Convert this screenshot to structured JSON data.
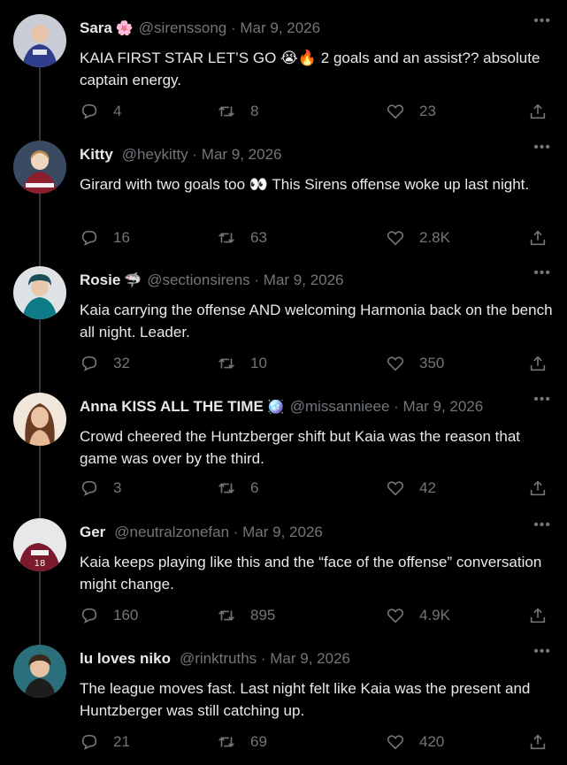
{
  "tweets": [
    {
      "name": "Sara",
      "emoji": "🌸",
      "handle": "@sirenssong",
      "date": "Mar 9, 2026",
      "text": "KAIA FIRST STAR LET’S GO 😭🔥 2 goals and an assist?? absolute captain energy.",
      "replies": "4",
      "retweets": "8",
      "likes": "23"
    },
    {
      "name": "Kitty",
      "emoji": "",
      "handle": "@heykitty",
      "date": "Mar 9, 2026",
      "text": "Girard with two goals too 👀 This Sirens offense woke up last night.",
      "replies": "16",
      "retweets": "63",
      "likes": "2.8K"
    },
    {
      "name": "Rosie",
      "emoji": "🦈",
      "handle": "@sectionsirens",
      "date": "Mar 9, 2026",
      "text": "Kaia carrying the offense AND welcoming Harmonia back on the bench all night. Leader.",
      "replies": "32",
      "retweets": "10",
      "likes": "350"
    },
    {
      "name": "Anna KISS ALL THE TIME",
      "emoji": "🪩",
      "handle": "@missannieee",
      "date": "Mar 9, 2026",
      "text": "Crowd cheered the Huntzberger shift but Kaia was the reason that game was over by the third.",
      "replies": "3",
      "retweets": "6",
      "likes": "42"
    },
    {
      "name": "Ger",
      "emoji": "",
      "handle": "@neutralzonefan",
      "date": "Mar 9, 2026",
      "text": "Kaia keeps playing like this and the “face of the offense” conversation might change.",
      "replies": "160",
      "retweets": "895",
      "likes": "4.9K"
    },
    {
      "name": "lu loves niko",
      "emoji": "",
      "handle": "@rinktruths",
      "date": "Mar 9, 2026",
      "text": "The league moves fast. Last night felt like Kaia was the present and Huntzberger was still catching up.",
      "replies": "21",
      "retweets": "69",
      "likes": "420"
    }
  ],
  "colors": {
    "background": "#000000",
    "text": "#e7e9ea",
    "muted": "#71767b",
    "thread": "#333639"
  },
  "icons": {
    "reply": "reply-icon",
    "retweet": "retweet-icon",
    "like": "heart-icon",
    "share": "share-icon",
    "more": "more-icon"
  }
}
